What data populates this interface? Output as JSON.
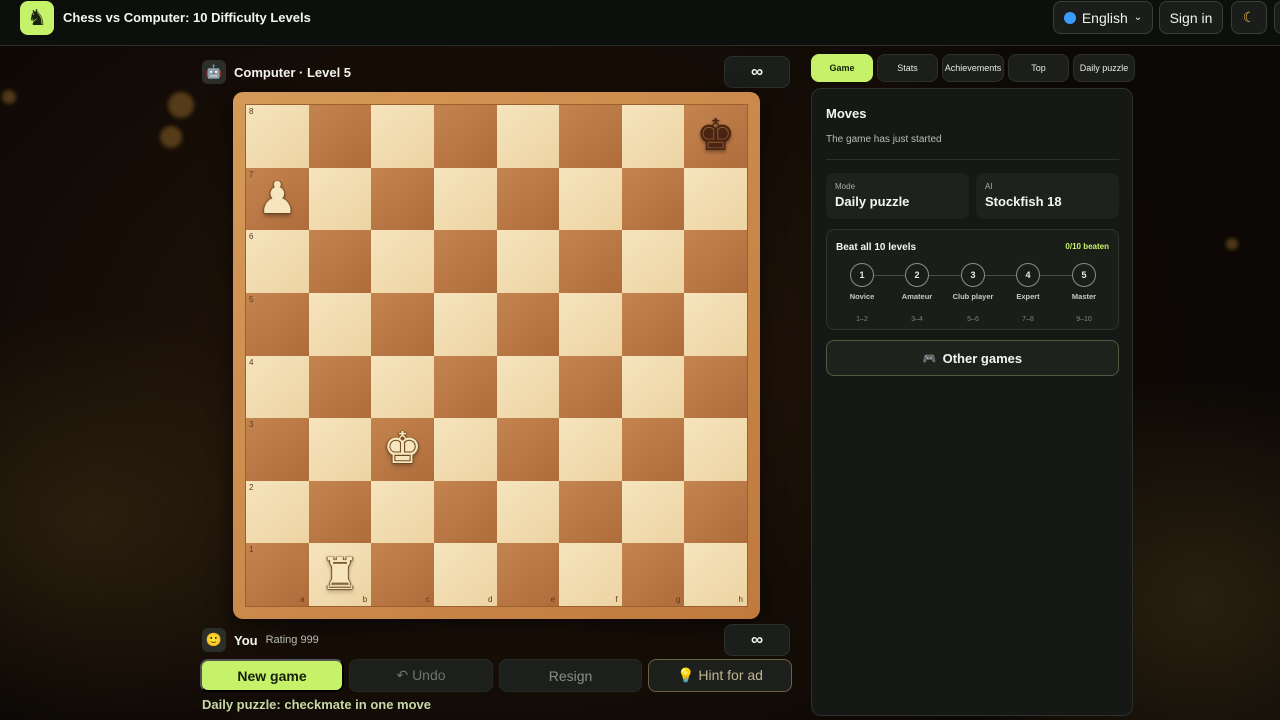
{
  "header": {
    "logo_icon": "knight-icon",
    "title": "Chess vs Computer: 10 Difficulty Levels",
    "language": "English",
    "sign_in": "Sign in",
    "theme_icon": "moon-icon"
  },
  "opponent": {
    "name": "Computer · Level 5",
    "avatar_icon": "robot-icon",
    "clock": "∞"
  },
  "player": {
    "name": "You",
    "rating": "Rating 999",
    "avatar_icon": "smiley-icon",
    "clock": "∞"
  },
  "board": {
    "files": [
      "a",
      "b",
      "c",
      "d",
      "e",
      "f",
      "g",
      "h"
    ],
    "ranks": [
      "8",
      "7",
      "6",
      "5",
      "4",
      "3",
      "2",
      "1"
    ],
    "pieces": [
      {
        "square": "h8",
        "color": "black",
        "type": "king",
        "glyph": "♚"
      },
      {
        "square": "a7",
        "color": "white",
        "type": "pawn",
        "glyph": "♟"
      },
      {
        "square": "c3",
        "color": "white",
        "type": "king",
        "glyph": "♚"
      },
      {
        "square": "b1",
        "color": "white",
        "type": "rook",
        "glyph": "♜"
      }
    ]
  },
  "controls": {
    "new_game": "New game",
    "undo": "↶ Undo",
    "resign": "Resign",
    "hint": "💡 Hint for ad"
  },
  "status": "Daily puzzle: checkmate in one move",
  "tabs": [
    {
      "label": "Game",
      "active": true
    },
    {
      "label": "Stats",
      "active": false
    },
    {
      "label": "Achievements",
      "active": false
    },
    {
      "label": "Top",
      "active": false
    },
    {
      "label": "Daily puzzle",
      "active": false
    }
  ],
  "panel": {
    "moves_title": "Moves",
    "moves_empty": "The game has just started",
    "mode_label": "Mode",
    "mode_value": "Daily puzzle",
    "ai_label": "AI",
    "ai_value": "Stockfish 18",
    "levels_title": "Beat all 10 levels",
    "levels_count": "0/10 beaten",
    "levels": [
      {
        "num": "1",
        "name": "Novice",
        "range": "1–2"
      },
      {
        "num": "2",
        "name": "Amateur",
        "range": "3–4"
      },
      {
        "num": "3",
        "name": "Club player",
        "range": "5–6"
      },
      {
        "num": "4",
        "name": "Expert",
        "range": "7–8"
      },
      {
        "num": "5",
        "name": "Master",
        "range": "9–10"
      }
    ],
    "other_games": "Other games",
    "other_games_icon": "gamepad-icon"
  },
  "colors": {
    "accent": "#c6f26a",
    "light_square": "#f0d9ab",
    "dark_square": "#b8763f"
  }
}
